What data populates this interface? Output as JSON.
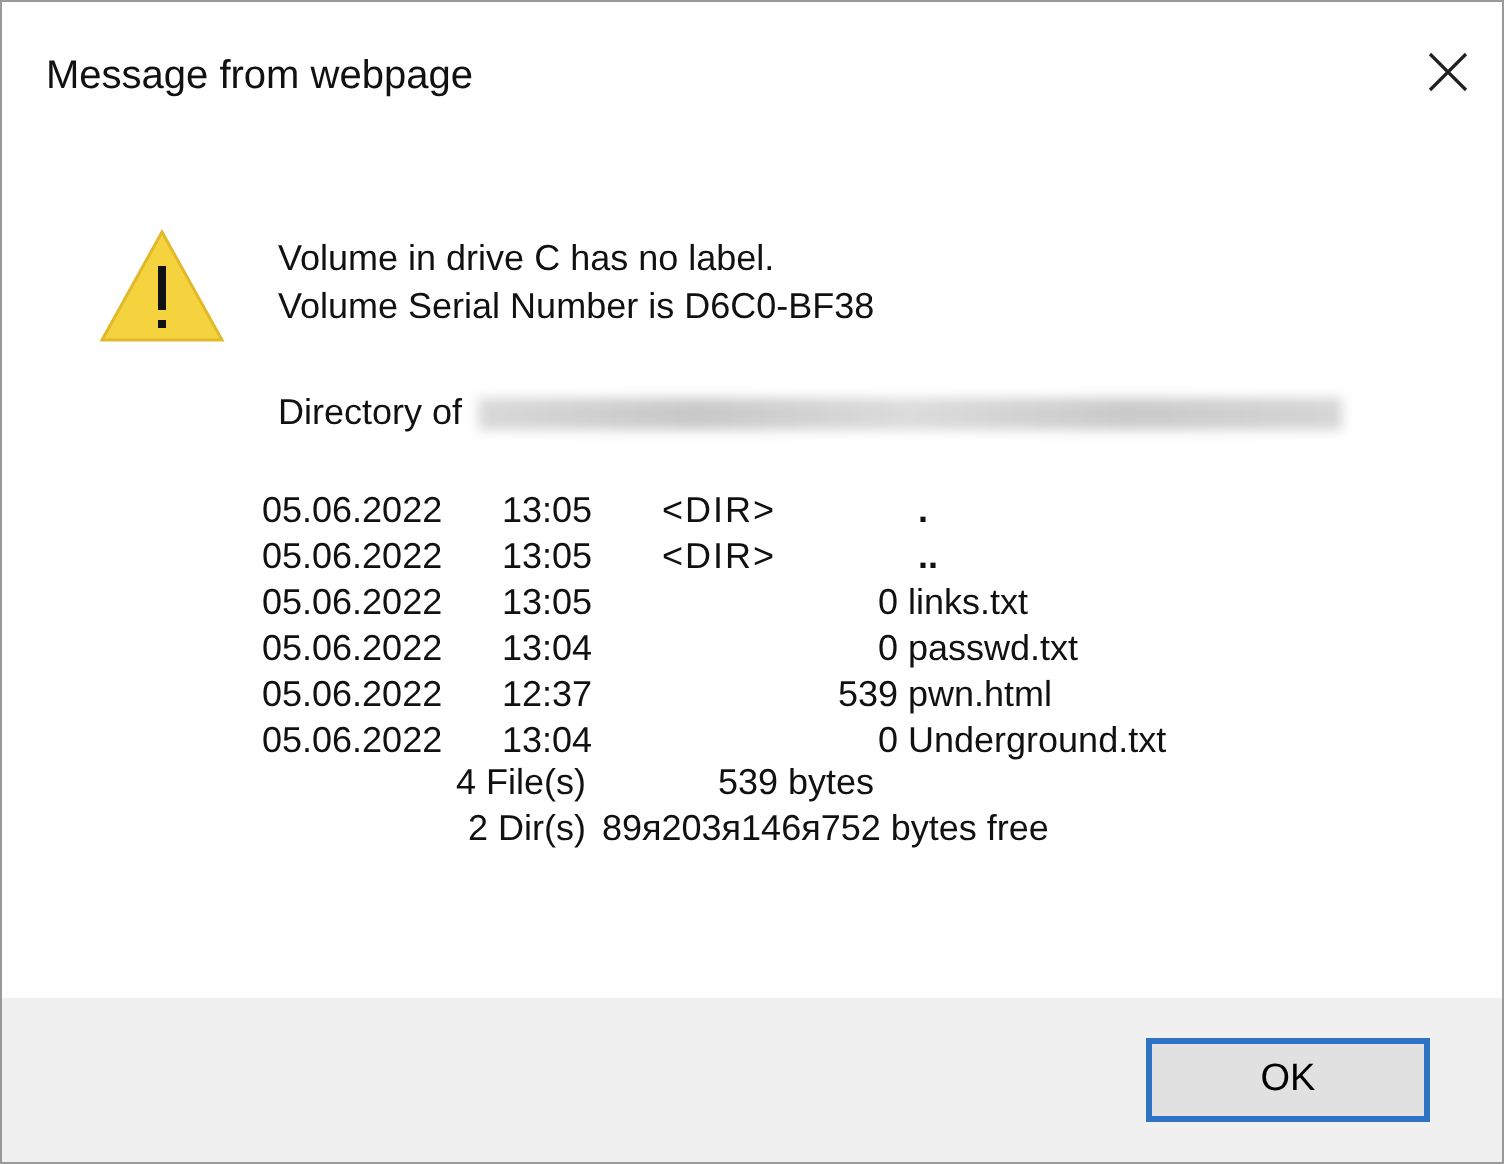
{
  "window": {
    "title": "Message from webpage"
  },
  "message": {
    "lines": [
      "Volume in drive C has no label.",
      "Volume Serial Number is D6C0-BF38"
    ],
    "directory_label": "Directory of",
    "path_redacted": true
  },
  "listing": [
    {
      "kind": "dir",
      "date": "05.06.2022",
      "time": "13:05",
      "type": "<DIR>",
      "name": "."
    },
    {
      "kind": "dir",
      "date": "05.06.2022",
      "time": "13:05",
      "type": "<DIR>",
      "name": ".."
    },
    {
      "kind": "file",
      "date": "05.06.2022",
      "time": "13:05",
      "size": "0",
      "name": "links.txt"
    },
    {
      "kind": "file",
      "date": "05.06.2022",
      "time": "13:04",
      "size": "0",
      "name": "passwd.txt"
    },
    {
      "kind": "file",
      "date": "05.06.2022",
      "time": "12:37",
      "size": "539",
      "name": "pwn.html"
    },
    {
      "kind": "file",
      "date": "05.06.2022",
      "time": "13:04",
      "size": "0",
      "name": "Underground.txt"
    }
  ],
  "summary": [
    {
      "count": "4 File(s)",
      "value": "539 bytes"
    },
    {
      "count": "2 Dir(s)",
      "value": "89я203я146я752 bytes free"
    }
  ],
  "buttons": [
    {
      "label": "OK",
      "default": true
    }
  ]
}
